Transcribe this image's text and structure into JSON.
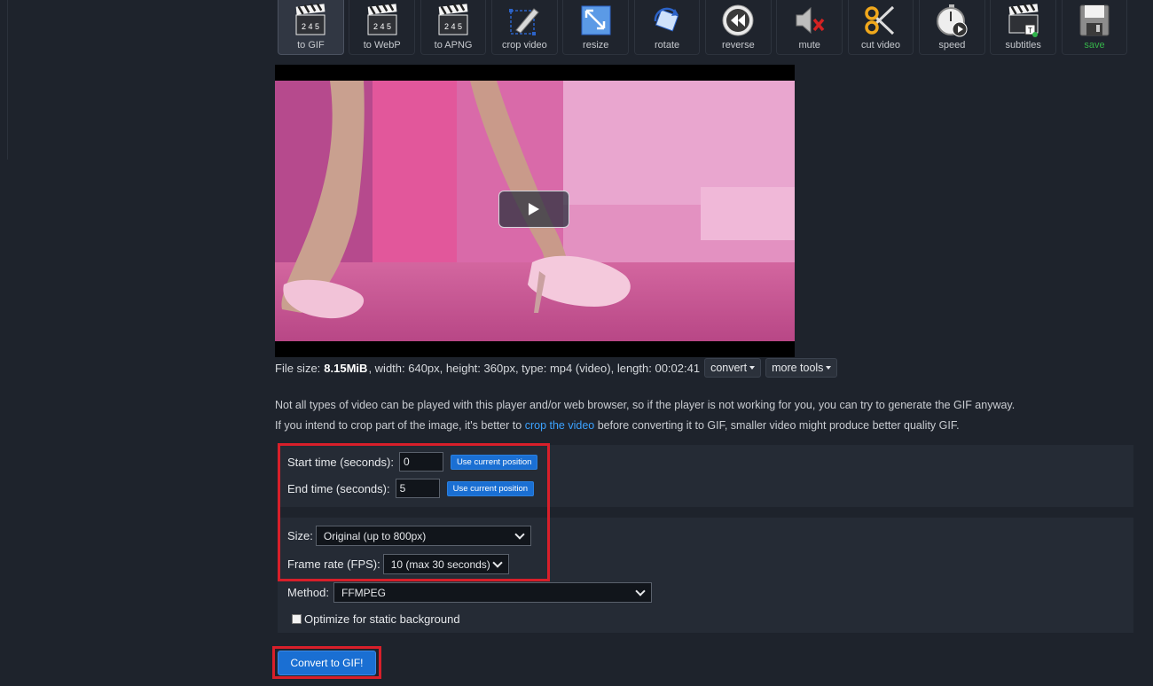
{
  "toolbar": {
    "tools": [
      {
        "label": "to GIF",
        "icon": "clapperboard-icon",
        "active": true
      },
      {
        "label": "to WebP",
        "icon": "clapperboard-icon"
      },
      {
        "label": "to APNG",
        "icon": "clapperboard-icon"
      },
      {
        "label": "crop video",
        "icon": "crop-icon"
      },
      {
        "label": "resize",
        "icon": "resize-icon"
      },
      {
        "label": "rotate",
        "icon": "rotate-icon"
      },
      {
        "label": "reverse",
        "icon": "rewind-icon"
      },
      {
        "label": "mute",
        "icon": "mute-speaker-icon"
      },
      {
        "label": "cut video",
        "icon": "scissors-icon"
      },
      {
        "label": "speed",
        "icon": "stopwatch-icon"
      },
      {
        "label": "subtitles",
        "icon": "subtitles-clapperboard-icon"
      },
      {
        "label": "save",
        "icon": "floppy-disk-icon"
      }
    ],
    "clapper_text": "2 4 5"
  },
  "video": {
    "play_icon": "play-icon"
  },
  "file_info": {
    "prefix": "File size:",
    "size": "8.15MiB",
    "rest": ", width: 640px, height: 360px, type: mp4 (video), length: 00:02:41",
    "convert_label": "convert",
    "more_tools_label": "more tools"
  },
  "notes": {
    "line1": "Not all types of video can be played with this player and/or web browser, so if the player is not working for you, you can try to generate the GIF anyway.",
    "line2_before": "If you intend to crop part of the image, it's better to ",
    "line2_link": "crop the video",
    "line2_after": " before converting it to GIF, smaller video might produce better quality GIF."
  },
  "form": {
    "start_label": "Start time (seconds):",
    "start_value": "0",
    "end_label": "End time (seconds):",
    "end_value": "5",
    "use_current": "Use current position",
    "size_label": "Size:",
    "size_value": "Original (up to 800px)",
    "fps_label": "Frame rate (FPS):",
    "fps_value": "10 (max 30 seconds)",
    "method_label": "Method:",
    "method_value": "FFMPEG",
    "optimize_label": "Optimize for static background",
    "convert_button": "Convert to GIF!"
  },
  "colors": {
    "background": "#1e232c",
    "accent_blue": "#1a6fd3",
    "highlight_red": "#d81f2a",
    "link_blue": "#3ca2ff"
  }
}
